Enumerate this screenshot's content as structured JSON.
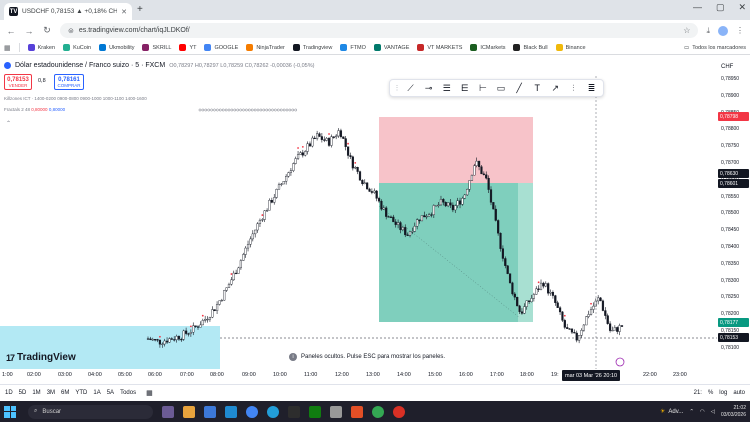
{
  "browser": {
    "tab_title": "USDCHF 0,78153 ▲ +0,18% CHF/USD",
    "tab_close": "✕",
    "new_tab": "+",
    "url": "es.tradingview.com/chart/iqJLDKOf/",
    "window_controls": [
      "—",
      "▢",
      "✕"
    ]
  },
  "bookmarks": {
    "items": [
      {
        "label": "Kraken",
        "color": "#5741d9"
      },
      {
        "label": "KuCoin",
        "color": "#23af91"
      },
      {
        "label": "Ukmobility",
        "color": "#0078d4"
      },
      {
        "label": "SKRILL",
        "color": "#862165"
      },
      {
        "label": "YT",
        "color": "#ff0000"
      },
      {
        "label": "GOOGLE",
        "color": "#4285f4"
      },
      {
        "label": "NinjaTrader",
        "color": "#f57c00"
      },
      {
        "label": "Tradingview",
        "color": "#131722"
      },
      {
        "label": "FTMO",
        "color": "#1e88e5"
      },
      {
        "label": "VANTAGE",
        "color": "#00796b"
      },
      {
        "label": "VT MARKETS",
        "color": "#c62828"
      },
      {
        "label": "ICMarkets",
        "color": "#1b5e20"
      },
      {
        "label": "Black Bull",
        "color": "#212121"
      },
      {
        "label": "Binance",
        "color": "#f0b90b"
      }
    ],
    "folder_label": "Todos los marcadores"
  },
  "chart": {
    "symbol": "Dólar estadounidense / Franco suizo · 5 · FXCM",
    "ohlc": "O0,78297 H0,78297 L0,78259 C0,78262 -0,00036 (-0,05%)",
    "sell_price": "0,78153",
    "sell_label": "VENDER",
    "spread": "0,8",
    "buy_price": "0,78161",
    "buy_label": "COMPRAR",
    "indicator1": "Killzones ICT · 1400-0200 0900-0800 0900-1000 1000-1100 1400-1600",
    "indicator2_name": "Fractals 2 48",
    "indicator2_val1": "0,80000",
    "indicator2_val2": "0,80000",
    "currency": "CHF",
    "price_labels": [
      "0,78950",
      "0,78900",
      "0,78850",
      "0,78800",
      "0,78750",
      "0,78700",
      "0,78650",
      "0,78550",
      "0,78500",
      "0,78450",
      "0,78400",
      "0,78350",
      "0,78300",
      "0,78250",
      "0,78200",
      "0,78150",
      "0,78100"
    ],
    "price_tags": {
      "red_top": "0,78798",
      "current": "0,78630",
      "box_mid": "0,78601",
      "green_bottom": "0,78177",
      "last": "0,78153"
    },
    "time_labels": [
      "1:00",
      "02:00",
      "03:00",
      "04:00",
      "05:00",
      "06:00",
      "07:00",
      "08:00",
      "09:00",
      "10:00",
      "11:00",
      "12:00",
      "13:00",
      "14:00",
      "15:00",
      "16:00",
      "17:00",
      "18:00",
      "19:",
      "22:00",
      "23:00"
    ],
    "time_cursor": "mar 03 Mar '26   20:10",
    "logo_text": "TradingView",
    "toast_text": "Paneles ocultos. Pulse ESC para mostrar los paneles.",
    "colors": {
      "up": "#131722",
      "down": "#131722",
      "stop_zone": "#f7c3c9",
      "target_zone": "#7fcfbd",
      "killzone": "#b3e9f4",
      "accent": "#2962ff"
    }
  },
  "chart_data": {
    "type": "candlestick",
    "series": [
      {
        "name": "USDCHF 5m",
        "close": [
          0.7812,
          0.7811,
          0.7812,
          0.7813,
          0.7815,
          0.7818,
          0.7822,
          0.7828,
          0.7835,
          0.7843,
          0.785,
          0.7856,
          0.7862,
          0.7868,
          0.7872,
          0.7876,
          0.7874,
          0.7878,
          0.7868,
          0.7862,
          0.7858,
          0.7852,
          0.7848,
          0.7845,
          0.785,
          0.7852,
          0.7855,
          0.7853,
          0.7857,
          0.7868,
          0.7862,
          0.7845,
          0.783,
          0.782,
          0.7825,
          0.783,
          0.7824,
          0.7815,
          0.7812,
          0.782,
          0.7825,
          0.7814,
          0.7816
        ]
      }
    ]
  },
  "timeframes": {
    "items": [
      "1D",
      "5D",
      "1M",
      "3M",
      "6M",
      "YTD",
      "1A",
      "5A",
      "Todos"
    ],
    "right": [
      "21:",
      "%",
      "log",
      "auto"
    ]
  },
  "taskbar": {
    "search_placeholder": "Buscar",
    "weather": "Adv...",
    "time": "21:02",
    "date": "03/03/2026"
  }
}
